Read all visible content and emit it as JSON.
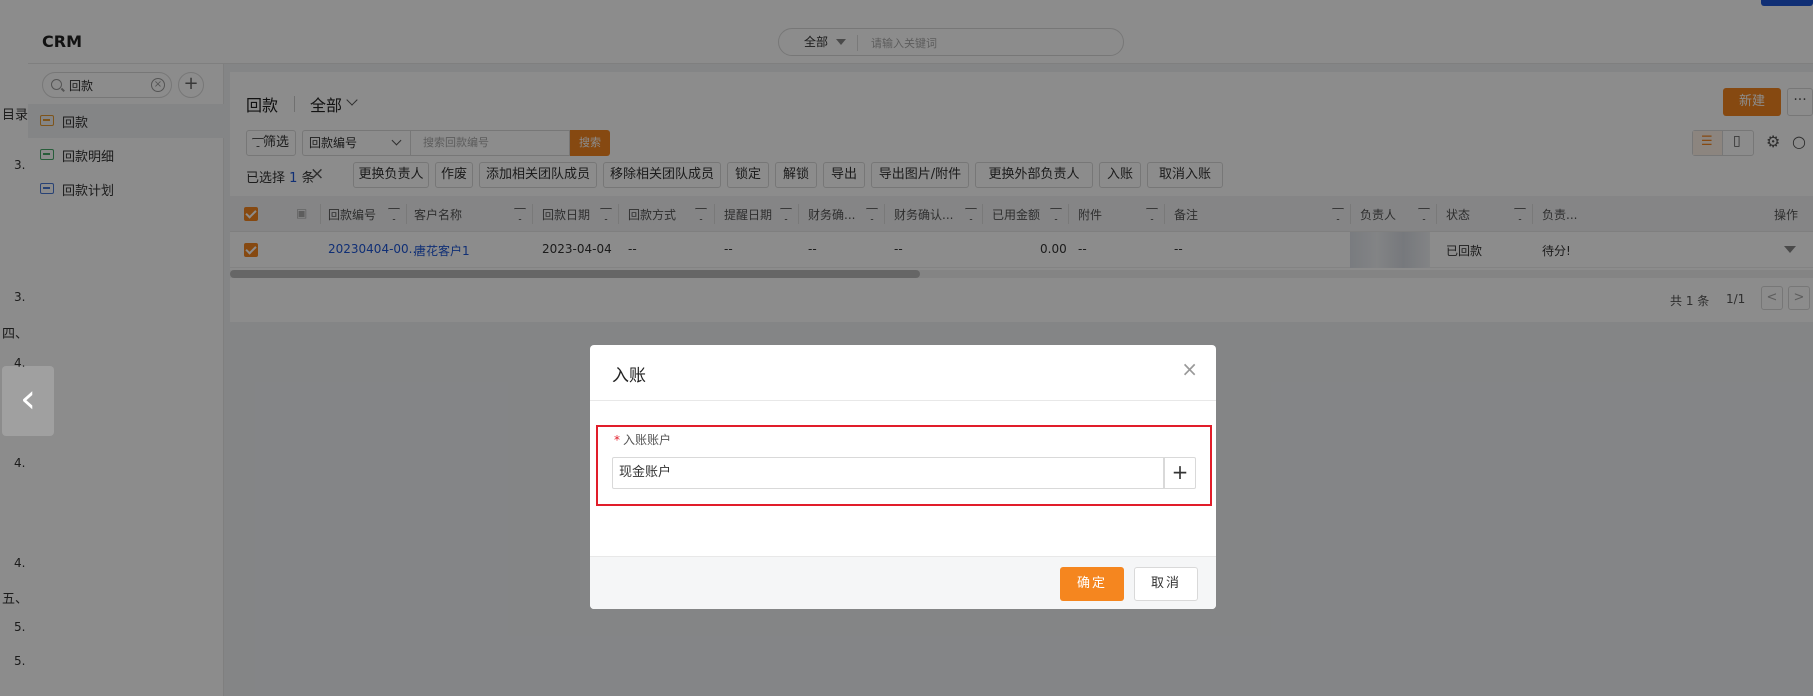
{
  "doc_marks": [
    "目录",
    "3.",
    "3.",
    "四、",
    "4.",
    "4.",
    "4.",
    "五、",
    "5.",
    "5."
  ],
  "app": {
    "title": "CRM",
    "search_scope": "全部",
    "search_placeholder": "请输入关键词"
  },
  "sidebar": {
    "search_value": "回款",
    "items": [
      {
        "label": "回款",
        "icon": "receipt-icon"
      },
      {
        "label": "回款明细",
        "icon": "receipt-detail-icon"
      },
      {
        "label": "回款计划",
        "icon": "payment-plan-icon"
      }
    ]
  },
  "list": {
    "title": "回款",
    "view": "全部",
    "new_label": "新建",
    "more_label": "···",
    "filter_label": "筛选",
    "field_select": "回款编号",
    "search_placeholder": "搜索回款编号",
    "search_button": "搜索",
    "selected_prefix": "已选择",
    "selected_count": "1",
    "selected_suffix": "条",
    "actions": [
      "更换负责人",
      "作废",
      "添加相关团队成员",
      "移除相关团队成员",
      "锁定",
      "解锁",
      "导出",
      "导出图片/附件",
      "更换外部负责人",
      "入账",
      "取消入账"
    ],
    "columns": [
      "回款编号",
      "客户名称",
      "回款日期",
      "回款方式",
      "提醒日期",
      "财务确...",
      "财务确认...",
      "已用金额",
      "附件",
      "备注",
      "负责人",
      "状态",
      "负责...",
      "操作"
    ],
    "row": {
      "code": "20230404-00...",
      "customer": "唐花客户1",
      "date": "2023-04-04",
      "method": "--",
      "remind": "--",
      "fin1": "--",
      "fin2": "--",
      "used": "0.00",
      "attach": "--",
      "remark": "--",
      "status": "已回款",
      "owner_status": "待分!"
    },
    "total": "共 1 条",
    "page": "1/1"
  },
  "modal": {
    "title": "入账",
    "field_label": "入账账户",
    "field_value": "现金账户",
    "ok": "确定",
    "cancel": "取消"
  }
}
